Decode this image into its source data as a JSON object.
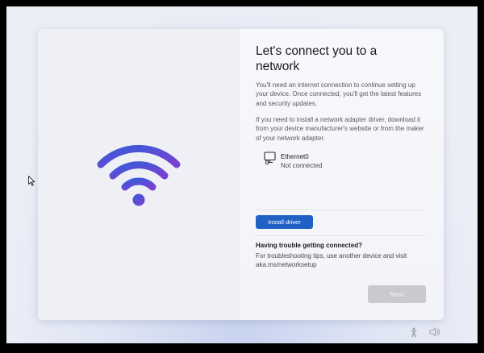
{
  "oobe": {
    "title": "Let's connect you to a network",
    "description_1": "You'll need an internet connection to continue setting up your device. Once connected, you'll get the latest features and security updates.",
    "description_2": "If you need to install a network adapter driver, download it from your device manufacturer's website or from the maker of your network adapter.",
    "illustration_icon": "wifi-icon",
    "networks": [
      {
        "icon": "monitor-icon",
        "name": "Ethernet0",
        "status": "Not connected"
      }
    ],
    "install_driver_label": "Install driver",
    "trouble_title": "Having trouble getting connected?",
    "trouble_text": "For troubleshooting tips, use another device and visit aka.ms/networksetup",
    "next_label": "Next"
  },
  "tray": {
    "accessibility_icon": "accessibility-icon",
    "volume_icon": "volume-icon"
  },
  "colors": {
    "accent": "#1f62c4",
    "wifi_gradient_start": "#3a5bd9",
    "wifi_gradient_end": "#7b3fd0",
    "disabled_button": "#c9cacd",
    "frame": "#000000"
  }
}
